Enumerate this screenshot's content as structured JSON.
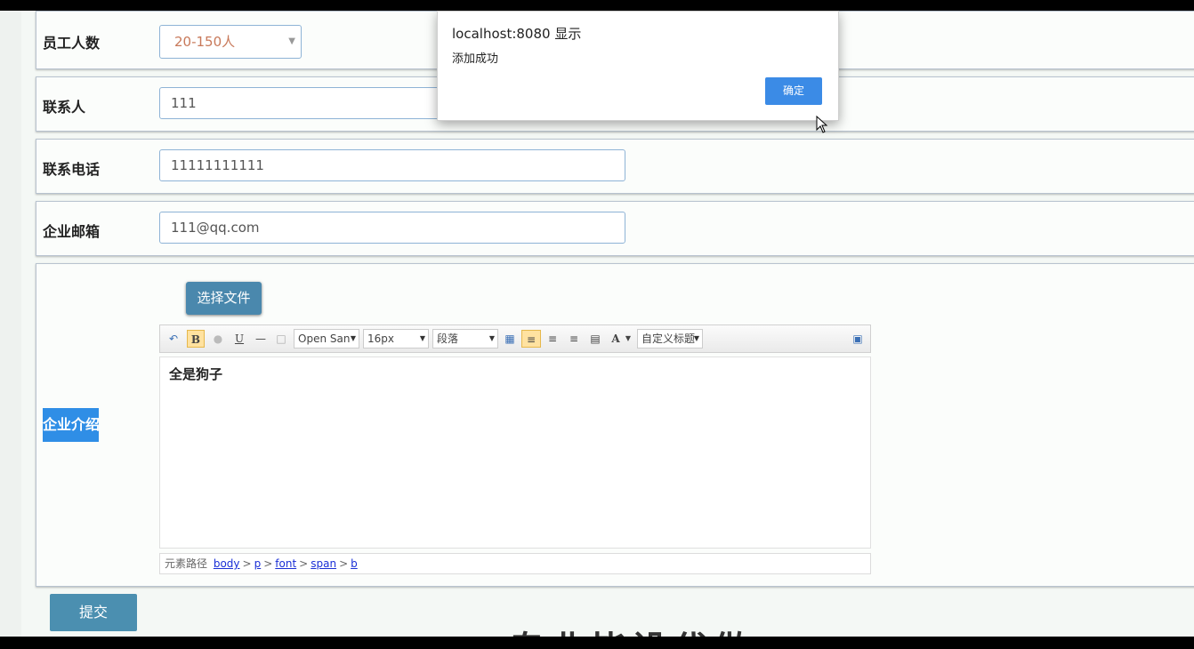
{
  "form": {
    "employees": {
      "label": "员工人数",
      "value": "20-150人"
    },
    "contact": {
      "label": "联系人",
      "value": "111"
    },
    "phone": {
      "label": "联系电话",
      "value": "11111111111"
    },
    "email": {
      "label": "企业邮箱",
      "value": "111@qq.com"
    },
    "intro": {
      "label": "企业介绍",
      "file_button": "选择文件",
      "toolbar": {
        "bold": "B",
        "underline": "U",
        "font_family": "Open San",
        "font_size": "16px",
        "paragraph": "段落",
        "font_color": "A",
        "custom_heading": "自定义标题"
      },
      "content": "全是狗子",
      "path_label": "元素路径",
      "path": [
        "body",
        "p",
        "font",
        "span",
        "b"
      ]
    },
    "submit": "提交"
  },
  "dialog": {
    "title": "localhost:8080 显示",
    "message": "添加成功",
    "ok": "确定"
  },
  "background_text": "专业毕设代做",
  "colors": {
    "accent": "#3b8be6",
    "submit": "#4b8fb0",
    "highlight": "#2f8ee6"
  }
}
